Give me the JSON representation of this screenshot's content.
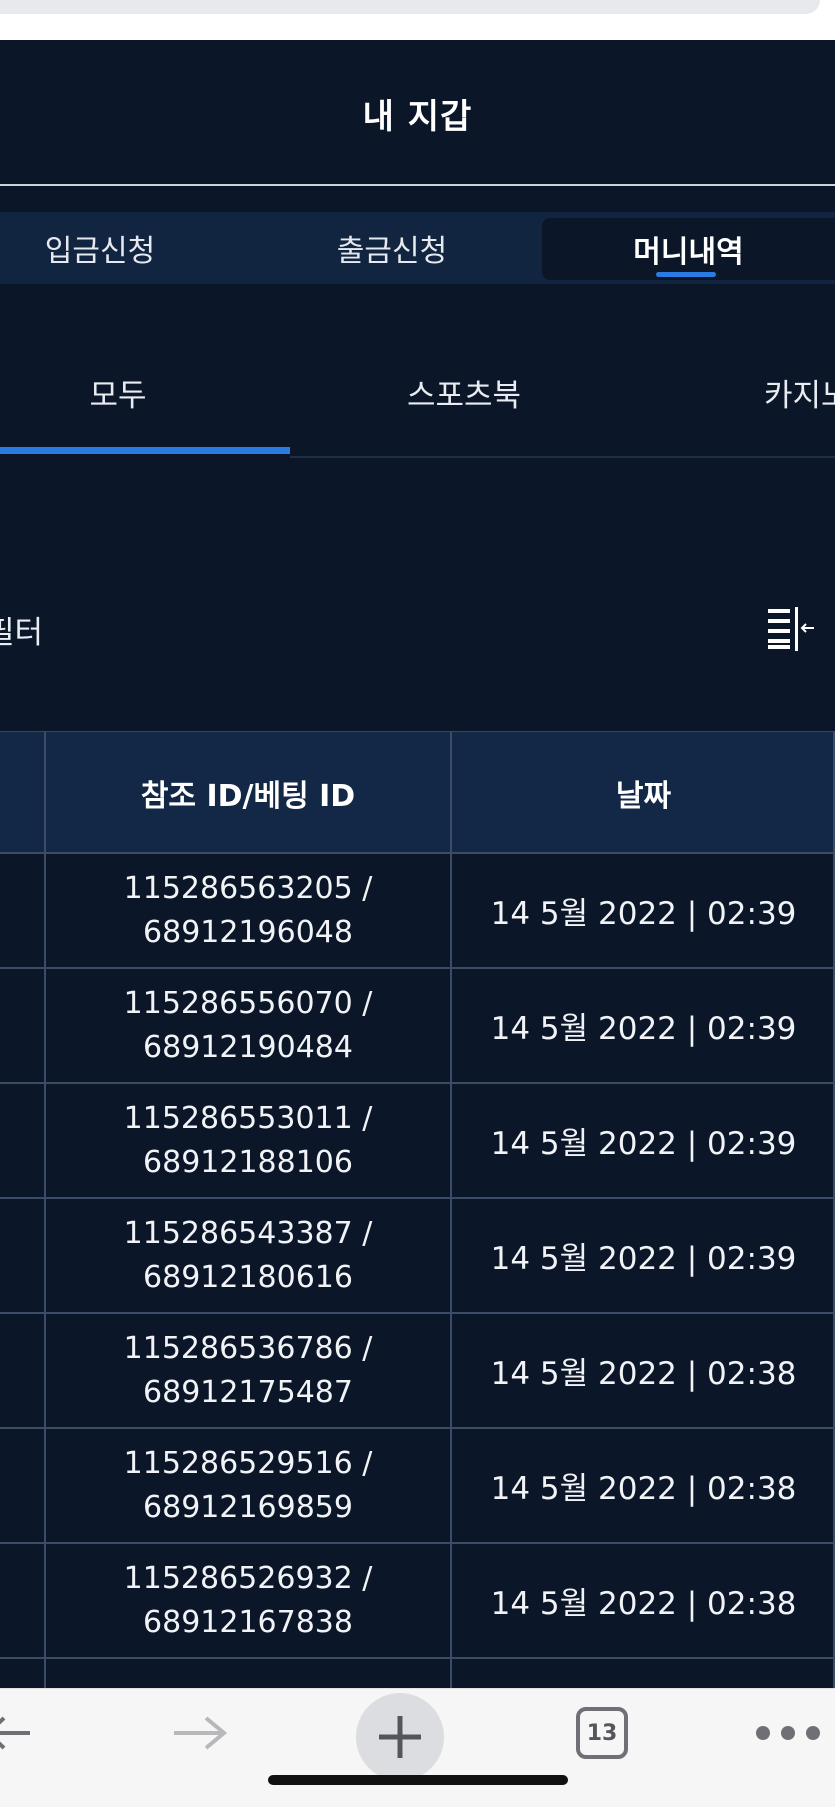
{
  "header": {
    "title": "내 지갑"
  },
  "tabs": [
    {
      "label": "입금신청"
    },
    {
      "label": "출금신청"
    },
    {
      "label": "머니내역",
      "active": true
    }
  ],
  "subtabs": [
    {
      "label": "모두",
      "active": true
    },
    {
      "label": "스포츠북"
    },
    {
      "label": "카지노"
    }
  ],
  "filter": {
    "label": "필터",
    "icon": "filter-collapse-icon"
  },
  "table": {
    "headers": {
      "ref_id": "참조 ID/베팅 ID",
      "date": "날짜"
    },
    "rows": [
      {
        "ref": "115286563205 /",
        "bet": "68912196048",
        "date": "14 5월 2022 | 02:39"
      },
      {
        "ref": "115286556070 /",
        "bet": "68912190484",
        "date": "14 5월 2022 | 02:39"
      },
      {
        "ref": "115286553011 /",
        "bet": "68912188106",
        "date": "14 5월 2022 | 02:39"
      },
      {
        "ref": "115286543387 /",
        "bet": "68912180616",
        "date": "14 5월 2022 | 02:39"
      },
      {
        "ref": "115286536786 /",
        "bet": "68912175487",
        "date": "14 5월 2022 | 02:38"
      },
      {
        "ref": "115286529516 /",
        "bet": "68912169859",
        "date": "14 5월 2022 | 02:38"
      },
      {
        "ref": "115286526932 /",
        "bet": "68912167838",
        "date": "14 5월 2022 | 02:38"
      }
    ]
  },
  "browser_toolbar": {
    "tab_count": "13"
  },
  "colors": {
    "background": "#0b1628",
    "accent": "#2b7be4",
    "tab_bar": "#122540",
    "table_header": "#132846"
  }
}
